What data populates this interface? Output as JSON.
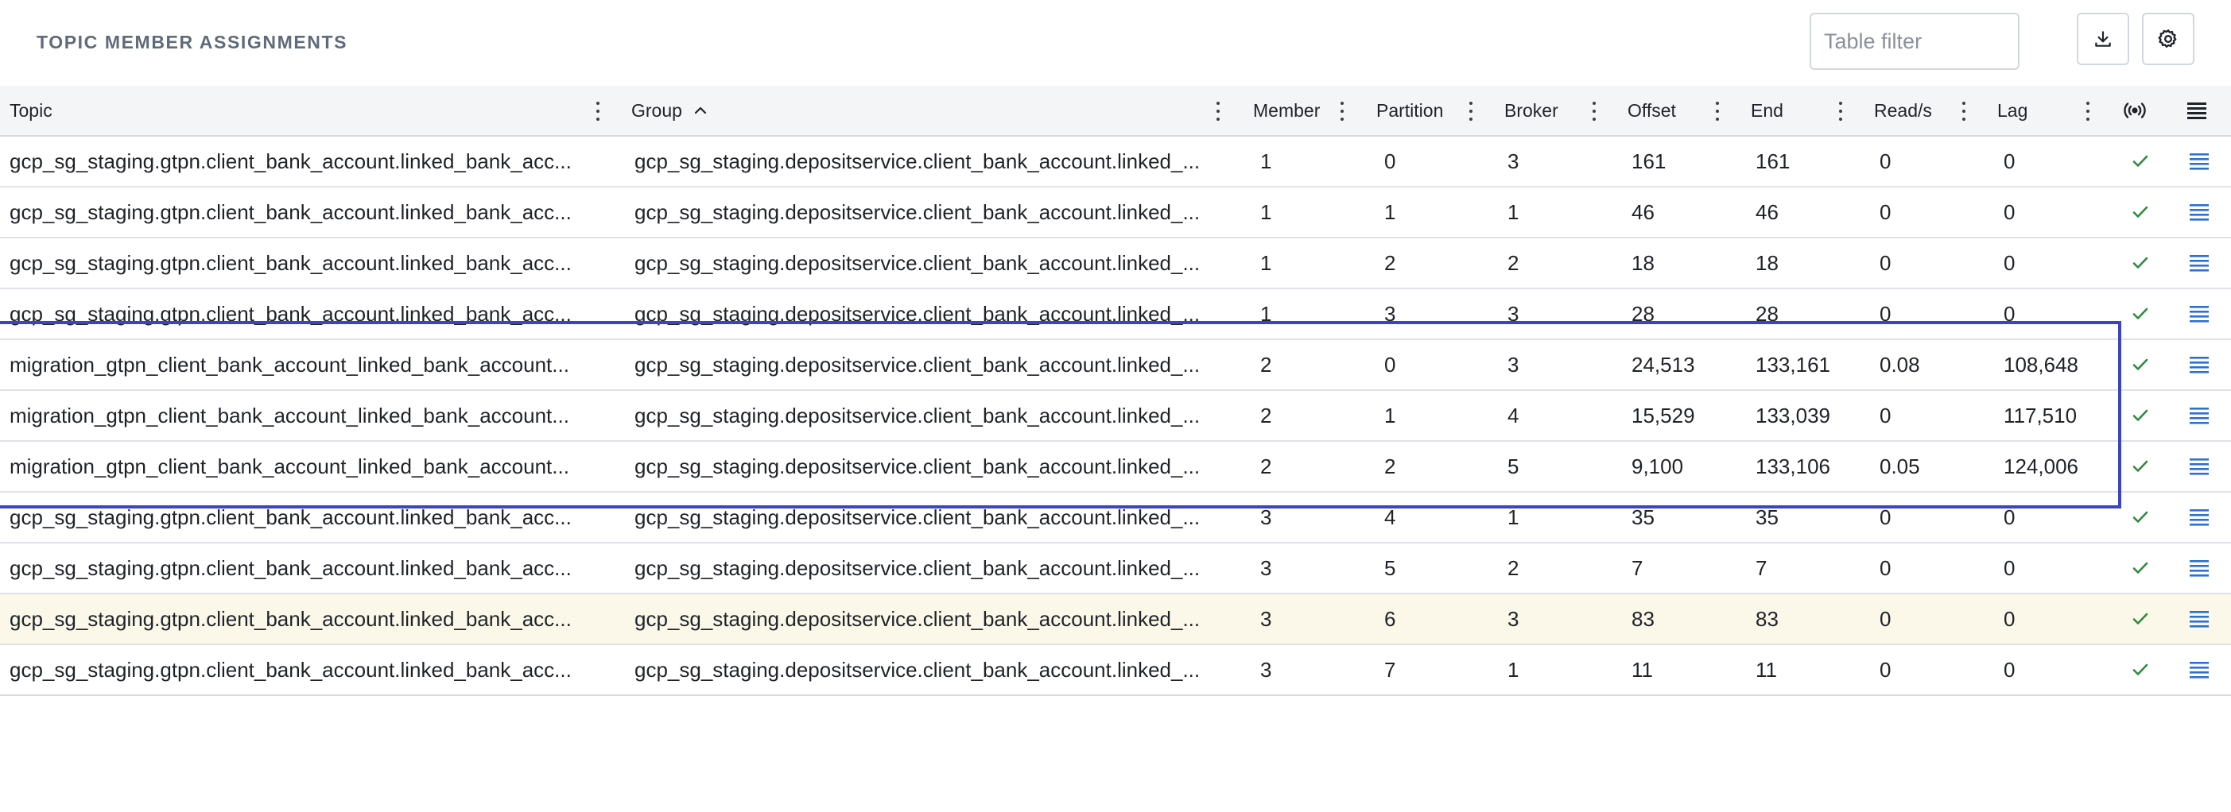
{
  "header": {
    "title": "TOPIC MEMBER ASSIGNMENTS",
    "filter_placeholder": "Table filter",
    "download_icon": "download-icon",
    "settings_icon": "gear-icon"
  },
  "table": {
    "columns": {
      "topic": "Topic",
      "group": "Group",
      "member": "Member",
      "partition": "Partition",
      "broker": "Broker",
      "offset": "Offset",
      "end": "End",
      "reads": "Read/s",
      "lag": "Lag",
      "status_icon": "broadcast-icon",
      "actions_icon": "list-icon"
    },
    "sort": {
      "column": "Group",
      "direction": "ascending"
    },
    "rows": [
      {
        "topic": "gcp_sg_staging.gtpn.client_bank_account.linked_bank_acc...",
        "group": "gcp_sg_staging.depositservice.client_bank_account.linked_...",
        "member": "1",
        "partition": "0",
        "broker": "3",
        "offset": "161",
        "end": "161",
        "reads": "0",
        "lag": "0"
      },
      {
        "topic": "gcp_sg_staging.gtpn.client_bank_account.linked_bank_acc...",
        "group": "gcp_sg_staging.depositservice.client_bank_account.linked_...",
        "member": "1",
        "partition": "1",
        "broker": "1",
        "offset": "46",
        "end": "46",
        "reads": "0",
        "lag": "0"
      },
      {
        "topic": "gcp_sg_staging.gtpn.client_bank_account.linked_bank_acc...",
        "group": "gcp_sg_staging.depositservice.client_bank_account.linked_...",
        "member": "1",
        "partition": "2",
        "broker": "2",
        "offset": "18",
        "end": "18",
        "reads": "0",
        "lag": "0"
      },
      {
        "topic": "gcp_sg_staging.gtpn.client_bank_account.linked_bank_acc...",
        "group": "gcp_sg_staging.depositservice.client_bank_account.linked_...",
        "member": "1",
        "partition": "3",
        "broker": "3",
        "offset": "28",
        "end": "28",
        "reads": "0",
        "lag": "0"
      },
      {
        "topic": "migration_gtpn_client_bank_account_linked_bank_account...",
        "group": "gcp_sg_staging.depositservice.client_bank_account.linked_...",
        "member": "2",
        "partition": "0",
        "broker": "3",
        "offset": "24,513",
        "end": "133,161",
        "reads": "0.08",
        "lag": "108,648"
      },
      {
        "topic": "migration_gtpn_client_bank_account_linked_bank_account...",
        "group": "gcp_sg_staging.depositservice.client_bank_account.linked_...",
        "member": "2",
        "partition": "1",
        "broker": "4",
        "offset": "15,529",
        "end": "133,039",
        "reads": "0",
        "lag": "117,510"
      },
      {
        "topic": "migration_gtpn_client_bank_account_linked_bank_account...",
        "group": "gcp_sg_staging.depositservice.client_bank_account.linked_...",
        "member": "2",
        "partition": "2",
        "broker": "5",
        "offset": "9,100",
        "end": "133,106",
        "reads": "0.05",
        "lag": "124,006"
      },
      {
        "topic": "gcp_sg_staging.gtpn.client_bank_account.linked_bank_acc...",
        "group": "gcp_sg_staging.depositservice.client_bank_account.linked_...",
        "member": "3",
        "partition": "4",
        "broker": "1",
        "offset": "35",
        "end": "35",
        "reads": "0",
        "lag": "0"
      },
      {
        "topic": "gcp_sg_staging.gtpn.client_bank_account.linked_bank_acc...",
        "group": "gcp_sg_staging.depositservice.client_bank_account.linked_...",
        "member": "3",
        "partition": "5",
        "broker": "2",
        "offset": "7",
        "end": "7",
        "reads": "0",
        "lag": "0"
      },
      {
        "topic": "gcp_sg_staging.gtpn.client_bank_account.linked_bank_acc...",
        "group": "gcp_sg_staging.depositservice.client_bank_account.linked_...",
        "member": "3",
        "partition": "6",
        "broker": "3",
        "offset": "83",
        "end": "83",
        "reads": "0",
        "lag": "0",
        "highlighted": true
      },
      {
        "topic": "gcp_sg_staging.gtpn.client_bank_account.linked_bank_acc...",
        "group": "gcp_sg_staging.depositservice.client_bank_account.linked_...",
        "member": "3",
        "partition": "7",
        "broker": "1",
        "offset": "11",
        "end": "11",
        "reads": "0",
        "lag": "0"
      }
    ]
  },
  "colors": {
    "selection_box": "#3b45c4",
    "check": "#2e8b3e",
    "row_menu": "#2c6fd6",
    "highlight_row": "#fbf8ea",
    "header_bg": "#f4f5f7"
  }
}
